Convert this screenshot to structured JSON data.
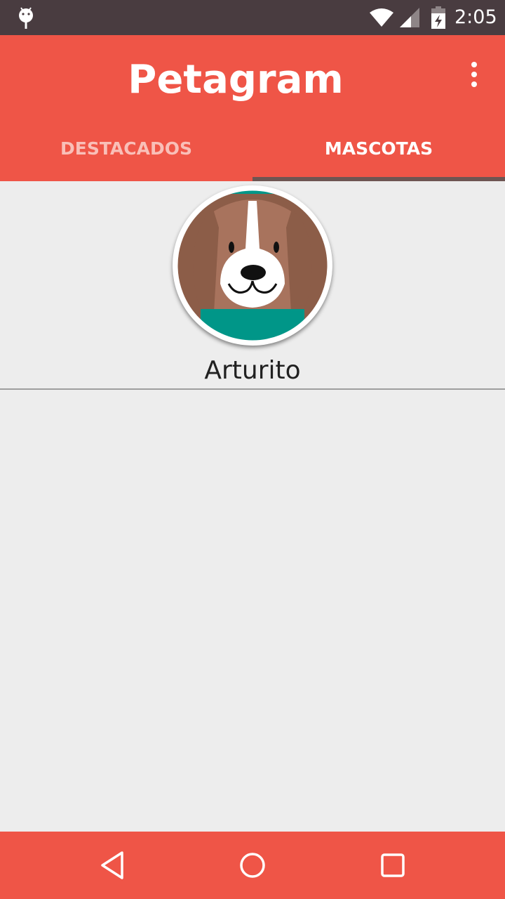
{
  "status_bar": {
    "time": "2:05",
    "icons": [
      "android-icon",
      "wifi-icon",
      "signal-icon",
      "battery-charging-icon"
    ]
  },
  "app_bar": {
    "title": "Petagram",
    "menu_icon": "overflow-menu-icon",
    "color": "#EF5547"
  },
  "tabs": [
    {
      "label": "DESTACADOS",
      "selected": false
    },
    {
      "label": "MASCOTAS",
      "selected": true
    }
  ],
  "pet": {
    "name": "Arturito",
    "avatar": "beagle-dog-avatar"
  },
  "nav_bar": {
    "icons": [
      "back-icon",
      "home-icon",
      "recents-icon"
    ]
  }
}
